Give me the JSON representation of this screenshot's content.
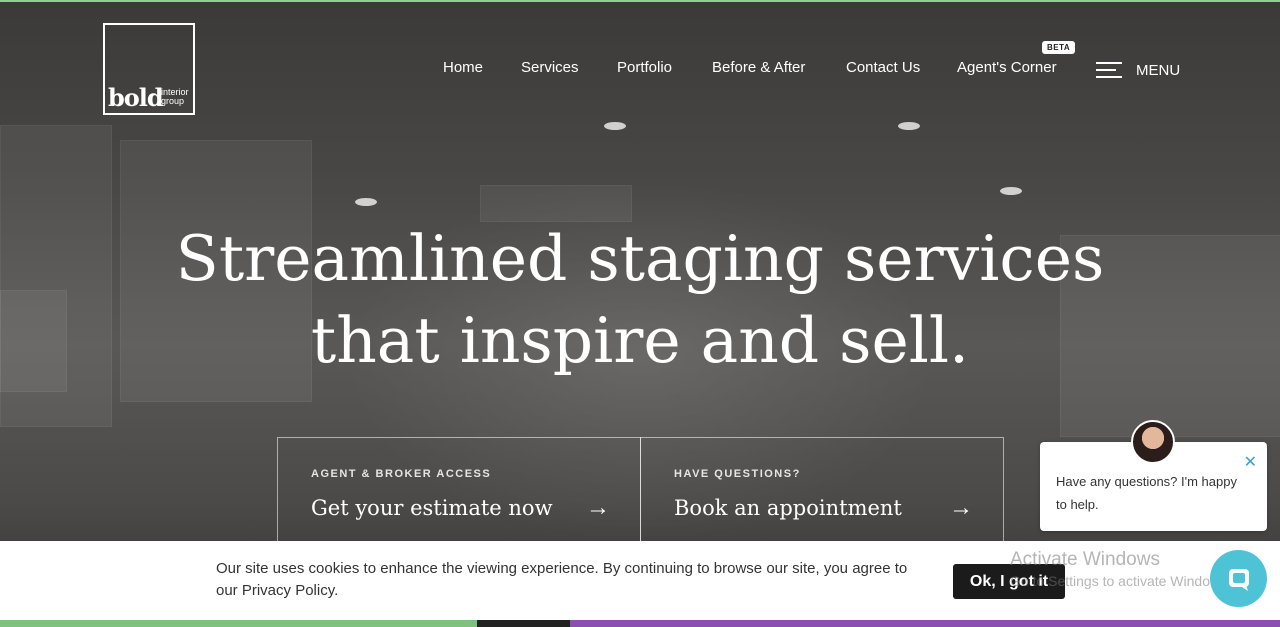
{
  "logo": {
    "wordmark": "bold",
    "sub1": "interior",
    "sub2": "group"
  },
  "nav": {
    "items": [
      {
        "label": "Home"
      },
      {
        "label": "Services"
      },
      {
        "label": "Portfolio"
      },
      {
        "label": "Before & After"
      },
      {
        "label": "Contact Us"
      },
      {
        "label": "Agent's Corner"
      }
    ],
    "badge": "BETA",
    "menu_label": "MENU"
  },
  "hero": {
    "headline_line1": "Streamlined staging services",
    "headline_line2": "that inspire and sell."
  },
  "cta": [
    {
      "kicker": "AGENT & BROKER ACCESS",
      "title": "Get your estimate now",
      "arrow": "→"
    },
    {
      "kicker": "HAVE QUESTIONS?",
      "title": "Book an appointment",
      "arrow": "→"
    }
  ],
  "cookie": {
    "text": "Our site uses cookies to enhance the viewing experience. By continuing to browse our site, you agree to our Privacy Policy.",
    "button": "Ok, I got it"
  },
  "chat": {
    "message": "Have any questions? I'm happy to help.",
    "close": "✕"
  },
  "watermark": {
    "line1": "Activate Windows",
    "line2": "Go to Settings to activate Windows."
  },
  "colors": {
    "chat_accent": "#4fc3d6",
    "button_dark": "#1b1b1b"
  }
}
